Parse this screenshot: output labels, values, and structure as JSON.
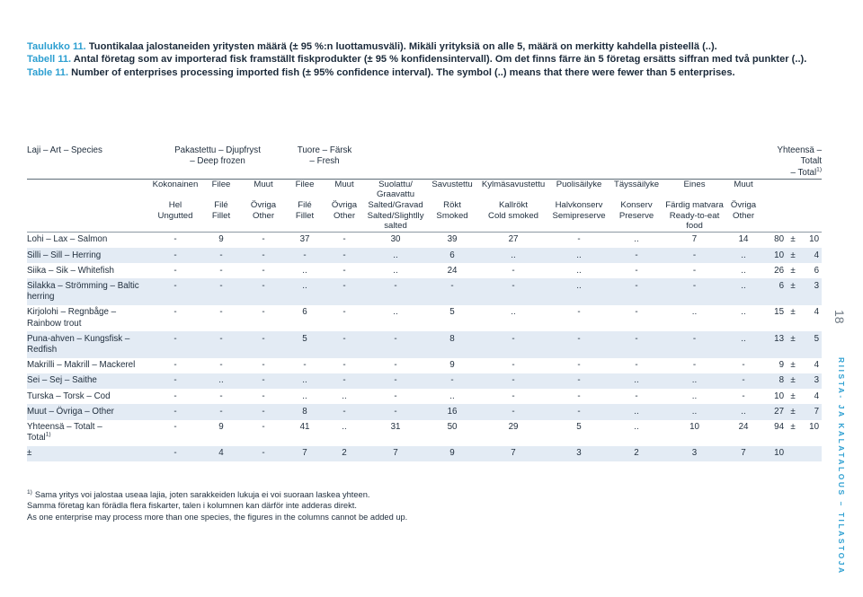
{
  "caption": {
    "fi_label": "Taulukko 11.",
    "fi_text": " Tuontikalaa jalostaneiden yritysten määrä (± 95 %:n luottamusväli). Mikäli yrityksiä on alle 5, määrä on merkitty kahdella pisteellä (..).",
    "sv_label": "Tabell 11.",
    "sv_text": " Antal företag som av importerad fisk framställt fiskprodukter (±  95 % konfidensintervall). Om det finns färre än 5 företag ersätts siffran med två punkter (..).",
    "en_label": "Table 11.",
    "en_text": " Number of enterprises processing imported fish (± 95% confidence interval). The symbol (..) means that there were fewer than 5 enterprises."
  },
  "table": {
    "species_header": "Laji – Art – Species",
    "groups": [
      {
        "line1": "Pakastettu – Djupfryst",
        "line2": "– Deep frozen"
      },
      {
        "line1": "Tuore – Färsk",
        "line2": "– Fresh"
      }
    ],
    "total_header": {
      "line1": "Yhteensä – Totalt",
      "line2": "– Total",
      "footnote_mark": "1)"
    },
    "columns_fi": [
      "Kokonainen",
      "Filee",
      "Muut",
      "Filee",
      "Muut",
      "Suolattu/ Graavattu",
      "Savustettu",
      "Kylmäsavustettu",
      "Puolisäilyke",
      "Täyssäilyke",
      "Eines",
      "Muut"
    ],
    "columns_sv": [
      "Hel",
      "Filé",
      "Övriga",
      "Filé",
      "Övriga",
      "Salted/Gravad",
      "Rökt",
      "Kallrökt",
      "Halvkonserv",
      "Konserv",
      "Färdig matvara",
      "Övriga"
    ],
    "columns_en": [
      "Ungutted",
      "Fillet",
      "Other",
      "Fillet",
      "Other",
      "Salted/Slightlly salted",
      "Smoked",
      "Cold smoked",
      "Semipreserve",
      "Preserve",
      "Ready-to-eat food",
      "Other"
    ],
    "rows": [
      {
        "species": "Lohi – Lax – Salmon",
        "values": [
          "-",
          "9",
          "-",
          "37",
          "-",
          "30",
          "39",
          "27",
          "-",
          "..",
          "7",
          "14"
        ],
        "total": "80",
        "pm": "±",
        "ci": "10"
      },
      {
        "species": "Silli – Sill – Herring",
        "values": [
          "-",
          "-",
          "-",
          "-",
          "-",
          "..",
          "6",
          "..",
          "..",
          "-",
          "-",
          ".."
        ],
        "total": "10",
        "pm": "±",
        "ci": "4"
      },
      {
        "species": "Siika – Sik – Whitefish",
        "values": [
          "-",
          "-",
          "-",
          "..",
          "-",
          "..",
          "24",
          "-",
          "..",
          "-",
          "-",
          ".."
        ],
        "total": "26",
        "pm": "±",
        "ci": "6"
      },
      {
        "species": "Silakka – Strömming – Baltic herring",
        "values": [
          "-",
          "-",
          "-",
          "..",
          "-",
          "-",
          "-",
          "-",
          "..",
          "-",
          "-",
          ".."
        ],
        "total": "6",
        "pm": "±",
        "ci": "3"
      },
      {
        "species": "Kirjolohi – Regnbåge – Rainbow trout",
        "values": [
          "-",
          "-",
          "-",
          "6",
          "-",
          "..",
          "5",
          "..",
          "-",
          "-",
          "..",
          ".."
        ],
        "total": "15",
        "pm": "±",
        "ci": "4"
      },
      {
        "species": "Puna-ahven – Kungsfisk – Redfish",
        "values": [
          "-",
          "-",
          "-",
          "5",
          "-",
          "-",
          "8",
          "-",
          "-",
          "-",
          "-",
          ".."
        ],
        "total": "13",
        "pm": "±",
        "ci": "5"
      },
      {
        "species": "Makrilli – Makrill – Mackerel",
        "values": [
          "-",
          "-",
          "-",
          "-",
          "-",
          "-",
          "9",
          "-",
          "-",
          "-",
          "-",
          "-"
        ],
        "total": "9",
        "pm": "±",
        "ci": "4"
      },
      {
        "species": "Sei – Sej – Saithe",
        "values": [
          "-",
          "..",
          "-",
          "..",
          "-",
          "-",
          "-",
          "-",
          "-",
          "..",
          "..",
          "-"
        ],
        "total": "8",
        "pm": "±",
        "ci": "3"
      },
      {
        "species": "Turska – Torsk – Cod",
        "values": [
          "-",
          "-",
          "-",
          "..",
          "..",
          "-",
          "..",
          "-",
          "-",
          "-",
          "..",
          "-"
        ],
        "total": "10",
        "pm": "±",
        "ci": "4"
      },
      {
        "species": "Muut – Övriga – Other",
        "values": [
          "-",
          "-",
          "-",
          "8",
          "-",
          "-",
          "16",
          "-",
          "-",
          "..",
          "..",
          ".."
        ],
        "total": "27",
        "pm": "±",
        "ci": "7"
      }
    ],
    "total_row": {
      "species_l1": "Yhteensä – Totalt –",
      "species_l2": "Total",
      "species_fn": "1)",
      "values": [
        "-",
        "9",
        "-",
        "41",
        "..",
        "31",
        "50",
        "29",
        "5",
        "..",
        "10",
        "24"
      ],
      "total": "94",
      "pm": "±",
      "ci": "10"
    },
    "pm_row": {
      "species": "±",
      "values": [
        "-",
        "4",
        "-",
        "7",
        "2",
        "7",
        "9",
        "7",
        "3",
        "2",
        "3",
        "7"
      ],
      "total": "10",
      "pm": "",
      "ci": ""
    }
  },
  "footnote": {
    "mark": "1)",
    "fi": "Sama yritys voi jalostaa useaa lajia, joten sarakkeiden lukuja ei voi suoraan laskea yhteen.",
    "sv": "Samma företag kan förädla flera fiskarter, talen i kolumnen kan därför inte adderas direkt.",
    "en": "As one enterprise may process more than one species, the figures in the columns cannot be added up."
  },
  "rail": {
    "page_number": "18",
    "series": "RIISTA- JA KALATALOUS – TILASTOJA"
  },
  "colors": {
    "accent": "#2d9fd1",
    "text": "#22303f",
    "row_alt": "#e3ebf4",
    "rule": "#5d6b77"
  }
}
